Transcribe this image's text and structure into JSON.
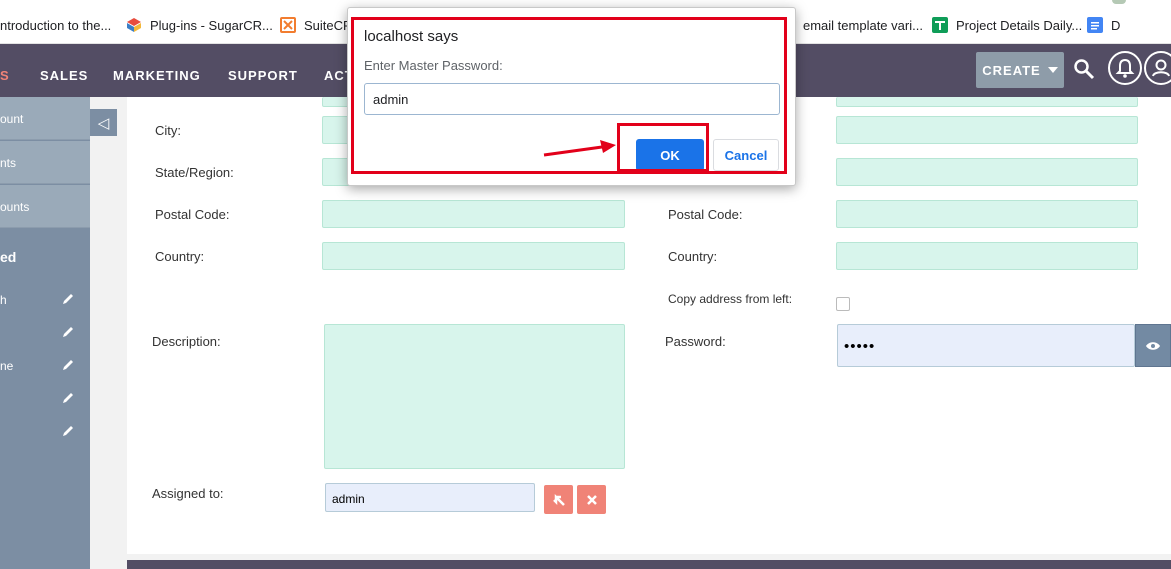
{
  "bookmarks": [
    {
      "label": "ntroduction to the...",
      "icon": "page-icon",
      "color": "#9aa0a6"
    },
    {
      "label": "Plug-ins - SugarCR...",
      "icon": "sugarcrm-cube-icon",
      "color": "#e8a33d"
    },
    {
      "label": "SuiteCRI",
      "icon": "xampp-icon",
      "color": "#f27d2f"
    },
    {
      "label": "email template vari...",
      "icon": "",
      "color": ""
    },
    {
      "label": "Project Details Daily...",
      "icon": "google-sheets-icon",
      "color": "#0f9d58"
    },
    {
      "label": "D",
      "icon": "google-docs-icon",
      "color": "#4285f4"
    }
  ],
  "nav": {
    "items": [
      "S",
      "SALES",
      "MARKETING",
      "SUPPORT",
      "ACT"
    ],
    "create_label": "CREATE"
  },
  "sidebar": {
    "links": [
      "ount",
      "nts",
      "ounts"
    ],
    "section_title": "ed",
    "recent_items": [
      "h",
      "",
      "ne",
      "",
      ""
    ]
  },
  "form": {
    "city_label": "City:",
    "state_label": "State/Region:",
    "postal_label": "Postal Code:",
    "country_label": "Country:",
    "postal_label_right": "Postal Code:",
    "country_label_right": "Country:",
    "copy_address_label": "Copy address from left:",
    "description_label": "Description:",
    "password_label": "Password:",
    "password_value": "•••••",
    "assigned_label": "Assigned to:",
    "assigned_value": "admin"
  },
  "dialog": {
    "title": "localhost says",
    "message": "Enter Master Password:",
    "input_value": "admin",
    "ok_label": "OK",
    "cancel_label": "Cancel"
  },
  "colors": {
    "nav_bg": "#534d64",
    "active_nav": "#f08377",
    "field_bg": "#d8f5ec",
    "ok_button": "#1a73e8",
    "highlight": "#e2001a",
    "select_button": "#f08377"
  }
}
